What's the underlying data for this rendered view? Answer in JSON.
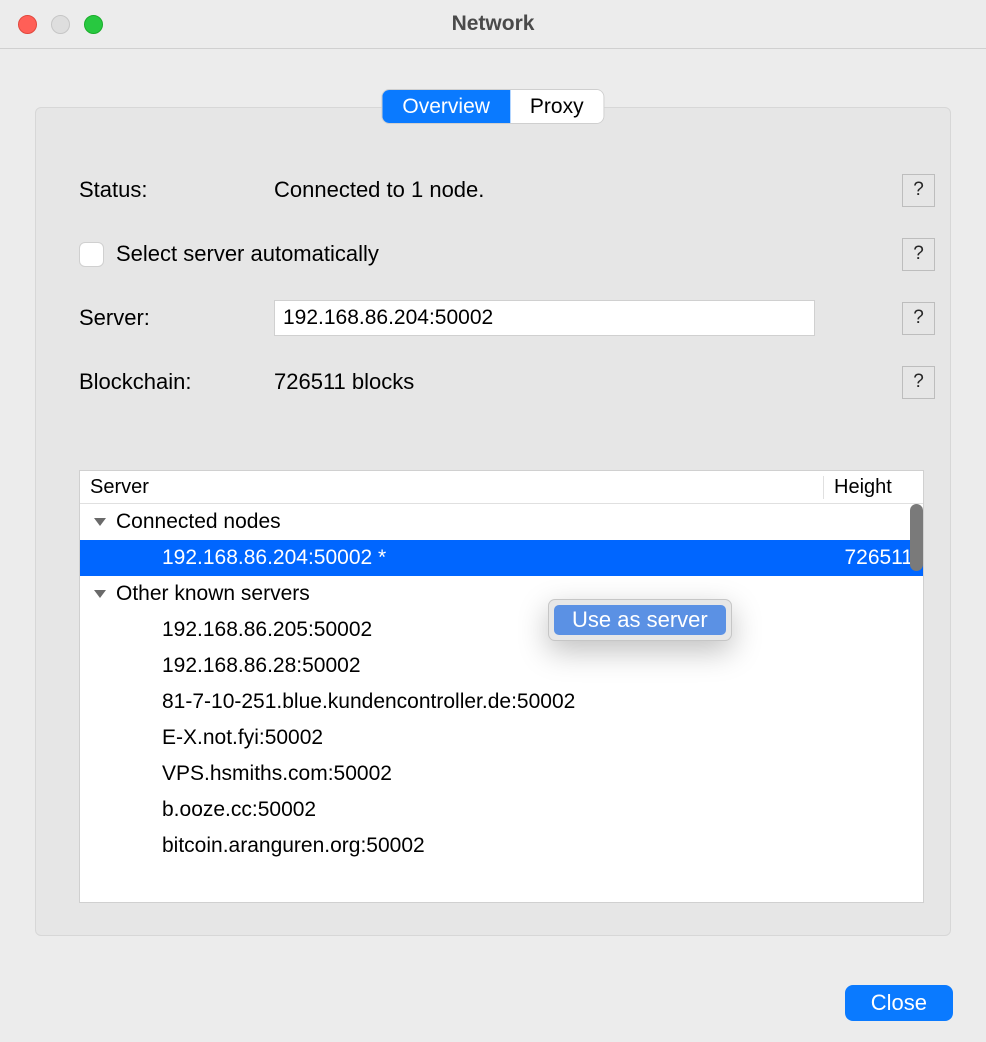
{
  "window": {
    "title": "Network"
  },
  "tabs": {
    "overview": "Overview",
    "proxy": "Proxy"
  },
  "form": {
    "status_label": "Status:",
    "status_value": "Connected to 1 node.",
    "auto_select_label": "Select server automatically",
    "auto_select_checked": false,
    "server_label": "Server:",
    "server_value": "192.168.86.204:50002",
    "blockchain_label": "Blockchain:",
    "blockchain_value": "726511 blocks",
    "help_glyph": "?"
  },
  "tree": {
    "header_server": "Server",
    "header_height": "Height",
    "group_connected": "Connected nodes",
    "group_other": "Other known servers",
    "selected_server": "192.168.86.204:50002 *",
    "selected_height": "726511",
    "others": [
      "192.168.86.205:50002",
      "192.168.86.28:50002",
      "81-7-10-251.blue.kundencontroller.de:50002",
      "E-X.not.fyi:50002",
      "VPS.hsmiths.com:50002",
      "b.ooze.cc:50002",
      "bitcoin.aranguren.org:50002"
    ]
  },
  "context_menu": {
    "use_as_server": "Use as server"
  },
  "buttons": {
    "close": "Close"
  }
}
